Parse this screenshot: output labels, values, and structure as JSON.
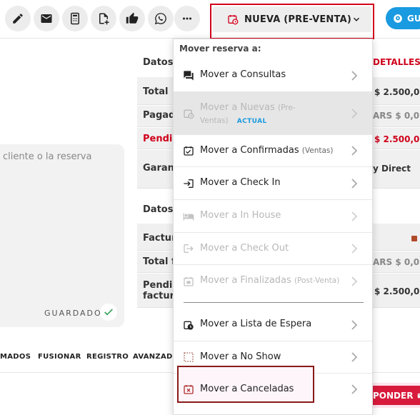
{
  "toolbar": {
    "icons": [
      "pencil-icon",
      "mail-icon",
      "calculator-icon",
      "add-document-icon",
      "thumbs-up-icon",
      "whatsapp-icon",
      "more-icon"
    ],
    "status_label": "NUEVA (PRE-VENTA)",
    "guide_label": "GU"
  },
  "background": {
    "datos_1": "Datos d",
    "detalles": "DETALLES",
    "total_label": "Total",
    "total_value": "$ 2.500,0",
    "pagado_label": "Pagado",
    "pagado_value": "ARS $ 0,0",
    "pendiente_label": "Pendie",
    "pendiente_value": "$ 2.500,0",
    "garantia_label": "Garant",
    "garantia_value": "y Direct",
    "datos_2": "Datos d",
    "factura_label": "Factura",
    "total_fact_label": "Total fa",
    "total_fact_value": "ARS $ 0,0",
    "pend_fact_label_1": "Pendie",
    "pend_fact_label_2": "factura",
    "pend_fact_value": "$ 2.500,0"
  },
  "notes": {
    "placeholder": "cliente o la reserva",
    "saved": "GUARDADO"
  },
  "tabs": [
    "MADOS",
    "FUSIONAR",
    "REGISTRO",
    "AVANZADO"
  ],
  "reply_label": "PONDER",
  "menu": {
    "header": "Mover reserva a:",
    "items": [
      {
        "label": "Mover a Consultas",
        "sub": "",
        "icon": "chat-icon"
      },
      {
        "label": "Mover a Nuevas",
        "sub": "(Pre-",
        "sub2": "Ventas)",
        "badge": "ACTUAL",
        "icon": "calendar-clock-icon"
      },
      {
        "label": "Mover a Confirmadas",
        "sub": "(Ventas)",
        "icon": "calendar-check-icon"
      },
      {
        "label": "Mover a Check In",
        "sub": "",
        "icon": "login-icon"
      },
      {
        "label": "Mover a In House",
        "sub": "",
        "icon": "bed-icon"
      },
      {
        "label": "Mover a Check Out",
        "sub": "",
        "icon": "logout-icon"
      },
      {
        "label": "Mover a Finalizadas",
        "sub": "(Post-Venta)",
        "icon": "calendar-done-icon"
      },
      {
        "label": "Mover a Lista de Espera",
        "sub": "",
        "icon": "waitlist-icon"
      },
      {
        "label": "Mover a No Show",
        "sub": "",
        "icon": "no-show-icon"
      },
      {
        "label": "Mover a Canceladas",
        "sub": "",
        "icon": "calendar-cancel-icon"
      }
    ]
  },
  "colors": {
    "accent_red": "#d0021b",
    "accent_blue": "#1a9ae0",
    "reply_pink": "#d81b3c"
  }
}
